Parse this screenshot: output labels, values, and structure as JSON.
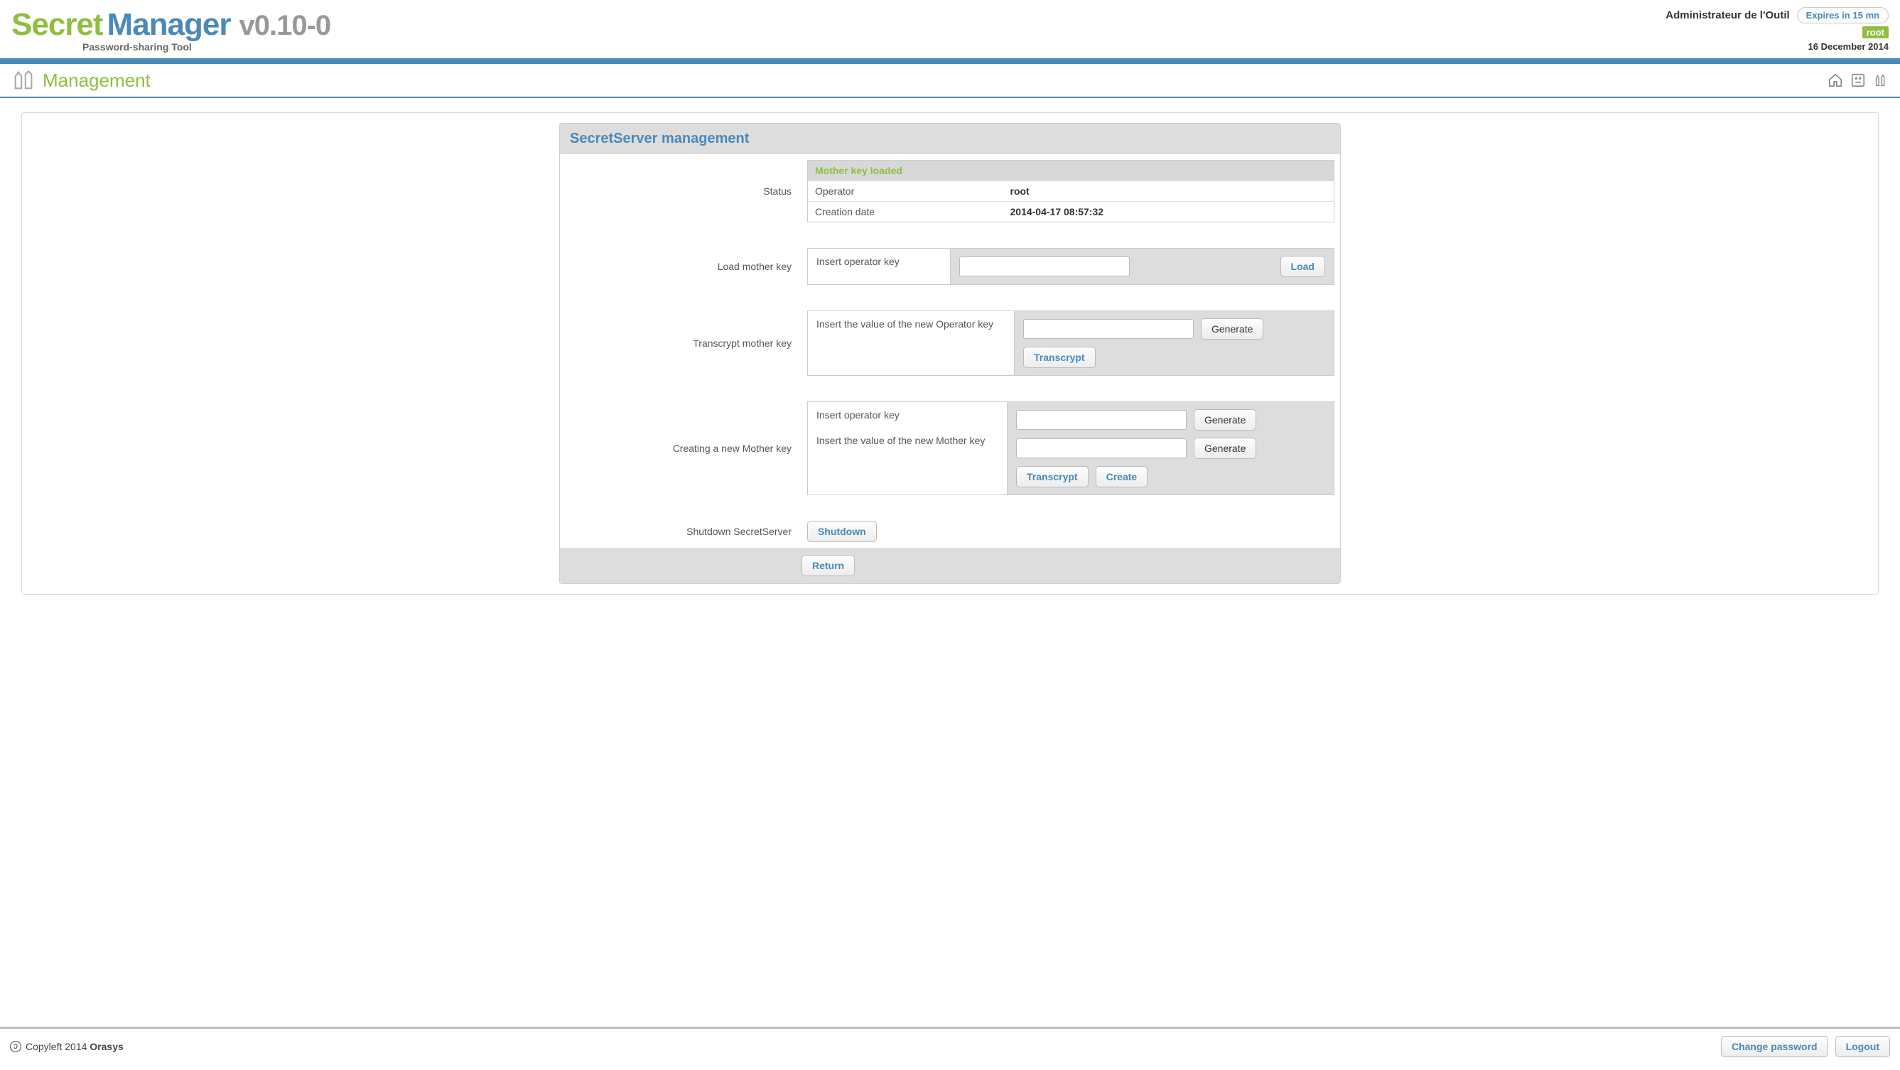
{
  "header": {
    "logo_secret": "Secret",
    "logo_manager": "Manager",
    "version": "v0.10-0",
    "tagline": "Password-sharing Tool",
    "admin_label": "Administrateur de l'Outil",
    "expires": "Expires in 15 mn",
    "user_badge": "root",
    "date": "16 December 2014"
  },
  "section": {
    "title": "Management"
  },
  "panel": {
    "title": "SecretServer management",
    "rows": {
      "status_label": "Status",
      "status_header": "Mother key loaded",
      "operator_label": "Operator",
      "operator_value": "root",
      "creation_label": "Creation date",
      "creation_value": "2014-04-17 08:57:32",
      "load_label": "Load mother key",
      "load_field_label": "Insert operator key",
      "load_button": "Load",
      "transcrypt_label": "Transcrypt mother key",
      "transcrypt_field_label": "Insert the value of the new Operator key",
      "generate_button": "Generate",
      "transcrypt_button": "Transcrypt",
      "create_label": "Creating a new Mother key",
      "create_field1_label": "Insert operator key",
      "create_field2_label": "Insert the value of the new Mother key",
      "create_button": "Create",
      "shutdown_label": "Shutdown SecretServer",
      "shutdown_button": "Shutdown",
      "return_button": "Return"
    }
  },
  "footer": {
    "copyleft_text": "Copyleft 2014 ",
    "copyleft_org": "Orasys",
    "change_password": "Change password",
    "logout": "Logout"
  }
}
